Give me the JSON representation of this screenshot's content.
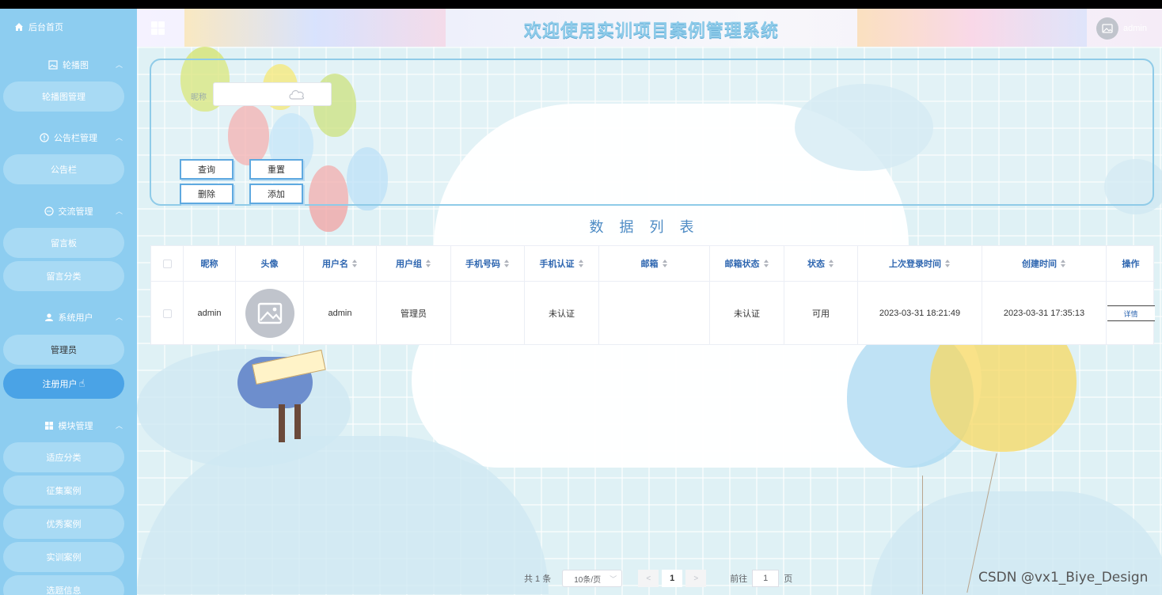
{
  "sidebar": {
    "home": "后台首页",
    "sections": [
      {
        "title": "轮播图",
        "icon": "image-icon",
        "items": [
          "轮播图管理"
        ]
      },
      {
        "title": "公告栏管理",
        "icon": "info-circle-icon",
        "items": [
          "公告栏"
        ]
      },
      {
        "title": "交流管理",
        "icon": "chat-icon",
        "items": [
          "留言板",
          "留言分类"
        ]
      },
      {
        "title": "系统用户",
        "icon": "user-icon",
        "items": [
          "管理员",
          "注册用户"
        ]
      },
      {
        "title": "模块管理",
        "icon": "grid-icon",
        "items": [
          "适应分类",
          "征集案例",
          "优秀案例",
          "实训案例",
          "选题信息"
        ]
      }
    ],
    "active_item": "注册用户"
  },
  "header": {
    "title": "欢迎使用实训项目案例管理系统",
    "user": "admin"
  },
  "search": {
    "nickname_label": "昵称",
    "buttons": {
      "query": "查询",
      "reset": "重置",
      "delete": "删除",
      "add": "添加"
    }
  },
  "list_title": "数据列表",
  "table": {
    "columns": [
      "昵称",
      "头像",
      "用户名",
      "用户组",
      "手机号码",
      "手机认证",
      "邮箱",
      "邮箱状态",
      "状态",
      "上次登录时间",
      "创建时间",
      "操作"
    ],
    "rows": [
      {
        "nickname": "admin",
        "username": "admin",
        "group": "管理员",
        "phone": "",
        "phone_auth": "未认证",
        "email": "",
        "email_status": "未认证",
        "status": "可用",
        "last_login": "2023-03-31 18:21:49",
        "created": "2023-03-31 17:35:13",
        "action": "详情"
      }
    ]
  },
  "pagination": {
    "total": "共 1 条",
    "page_size": "10条/页",
    "current": "1",
    "goto_label": "前往",
    "goto_value": "1",
    "page_suffix": "页"
  },
  "watermark": "CSDN @vx1_Biye_Design",
  "colors": {
    "sidebar": "#8dcdf0",
    "active": "#4aa3e6",
    "title": "#8ecbe9",
    "header_text": "#2e66b0"
  }
}
